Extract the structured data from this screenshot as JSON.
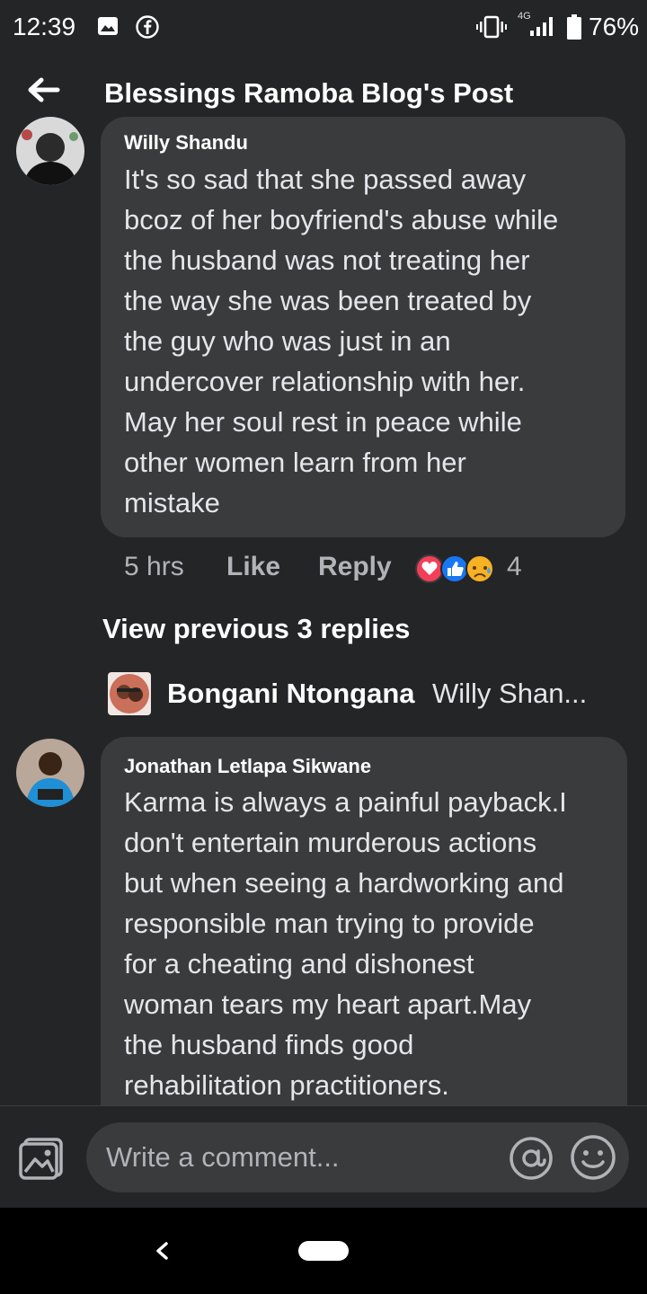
{
  "status_bar": {
    "time": "12:39",
    "network": "4G",
    "battery": "76%",
    "icons": [
      "gallery-icon",
      "facebook-icon",
      "vibrate-icon",
      "signal-icon",
      "battery-icon"
    ]
  },
  "header": {
    "title": "Blessings Ramoba Blog's Post",
    "back_icon": "arrow-left-icon"
  },
  "comments": [
    {
      "author": "Willy Shandu",
      "lines": [
        "It's so sad that she passed away",
        "bcoz of her boyfriend's abuse while",
        "the husband was not treating her",
        "the way she was been treated by",
        "the guy who was just in an",
        "undercover relationship with her.",
        "May her soul rest in peace while",
        "other women learn from her",
        "mistake"
      ],
      "time": "5 hrs",
      "like_label": "Like",
      "reply_label": "Reply",
      "reactions": [
        "love",
        "like",
        "sad"
      ],
      "reaction_count": "4"
    },
    {
      "author": "Jonathan Letlapa Sikwane",
      "lines": [
        "Karma is always a painful payback.I",
        "don't  entertain  murderous actions",
        "but when seeing a hardworking and",
        "responsible man trying to provide",
        "for a cheating  and dishonest",
        "woman tears my heart apart.May",
        "the husband finds good",
        "rehabilitation  practitioners."
      ]
    }
  ],
  "view_previous": "View previous 3 replies",
  "latest_reply": {
    "name": "Bongani Ntongana",
    "preview": "Willy Shan..."
  },
  "composer": {
    "placeholder": "Write a comment..."
  },
  "colors": {
    "background": "#242526",
    "bubble": "#3a3b3c",
    "text": "#e4e6eb",
    "muted": "#b0b3b8",
    "love": "#f33e58",
    "like": "#1877f2",
    "sad": "#f7b125"
  }
}
